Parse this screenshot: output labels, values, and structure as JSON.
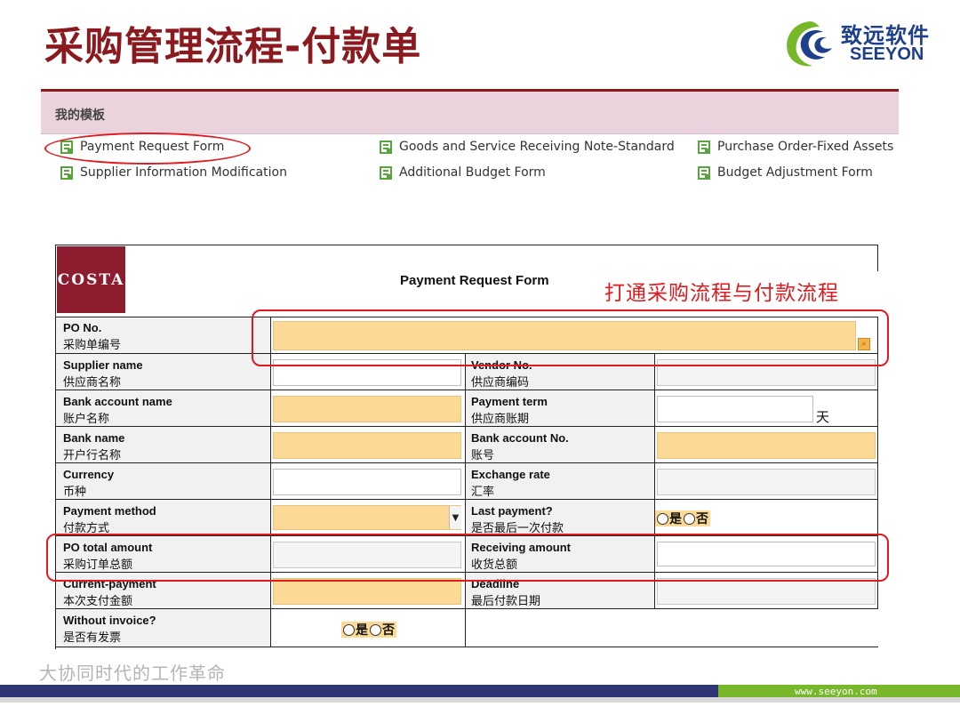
{
  "slide": {
    "title": "采购管理流程-付款单",
    "tagline": "大协同时代的工作革命",
    "footer_url": "www.seeyon.com"
  },
  "logo": {
    "cn": "致远软件",
    "en": "SEEYON"
  },
  "templates": {
    "panel_title": "我的模板",
    "items": [
      "Payment Request Form",
      "Goods and Service Receiving Note-Standard",
      "Purchase Order-Fixed Assets",
      "Supplier Information Modification",
      "Additional Budget Form",
      "Budget Adjustment Form"
    ],
    "icon": "document-icon"
  },
  "form": {
    "brand": "COSTA",
    "title": "Payment Request Form",
    "annotation": "打通采购流程与付款流程",
    "fields": {
      "po_no": {
        "en": "PO No.",
        "cn": "采购单编号"
      },
      "supplier_name": {
        "en": "Supplier name",
        "cn": "供应商名称"
      },
      "vendor_no": {
        "en": "Vendor No.",
        "cn": "供应商编码"
      },
      "bank_account_name": {
        "en": "Bank account name",
        "cn": "账户名称"
      },
      "payment_term": {
        "en": "Payment term",
        "cn": "供应商账期",
        "unit": "天"
      },
      "bank_name": {
        "en": "Bank name",
        "cn": "开户行名称"
      },
      "bank_account_no": {
        "en": "Bank account No.",
        "cn": "账号"
      },
      "currency": {
        "en": "Currency",
        "cn": "币种"
      },
      "exchange_rate": {
        "en": "Exchange rate",
        "cn": "汇率"
      },
      "payment_method": {
        "en": "Payment method",
        "cn": "付款方式"
      },
      "last_payment": {
        "en": "Last payment?",
        "cn": "是否最后一次付款",
        "yes": "是",
        "no": "否"
      },
      "po_total_amount": {
        "en": "PO total amount",
        "cn": "采购订单总额"
      },
      "receiving_amount": {
        "en": "Receiving amount",
        "cn": "收货总额"
      },
      "current_payment": {
        "en": "Current-payment",
        "cn": "本次支付金额"
      },
      "deadline": {
        "en": "Deadline",
        "cn": "最后付款日期"
      },
      "without_invoice": {
        "en": "Without invoice?",
        "cn": "是否有发票",
        "yes": "是",
        "no": "否"
      }
    },
    "colors": {
      "required_field": "#fcd995",
      "highlight": "#e01a1f",
      "brand": "#8e1c2f"
    }
  }
}
